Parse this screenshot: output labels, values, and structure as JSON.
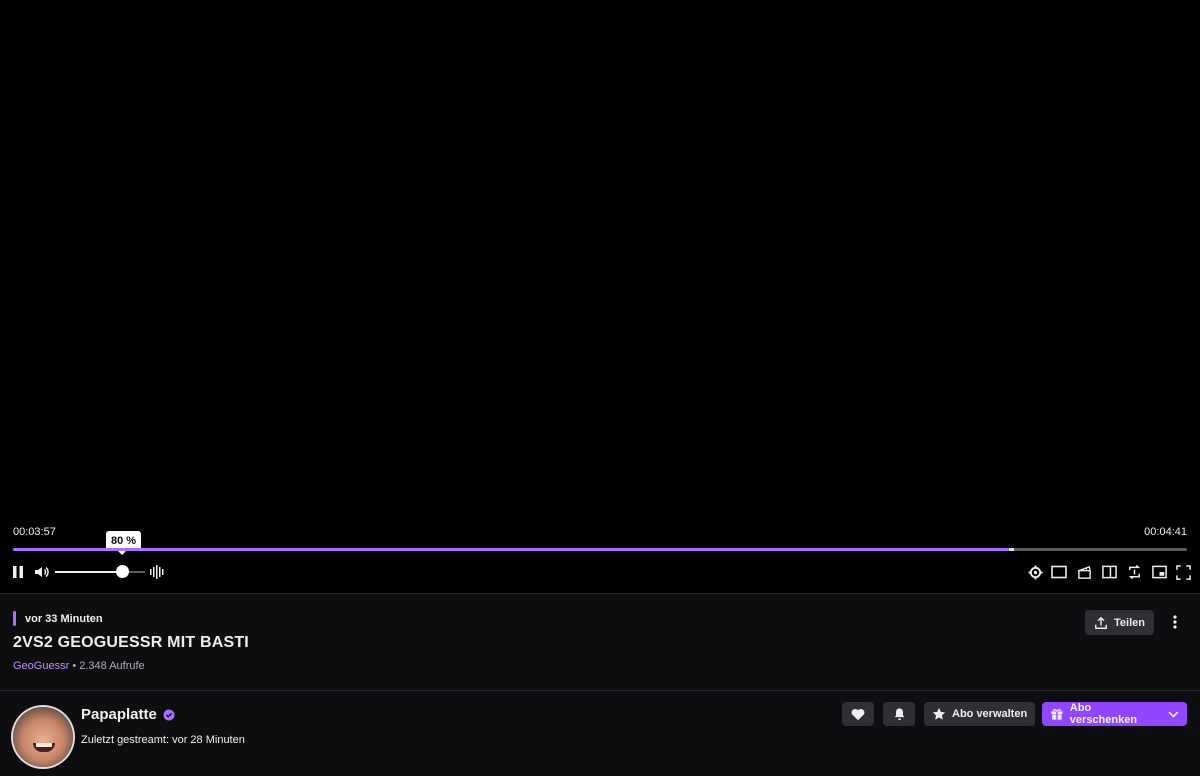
{
  "player": {
    "current_time": "00:03:57",
    "duration": "00:04:41",
    "progress_fraction": 0.848,
    "buffer_end_fraction": 0.853,
    "volume_tooltip": "80 %",
    "volume_fraction": 0.75,
    "accent_color": "#a970ff",
    "left_controls": [
      "pause-icon",
      "volume-icon",
      "audio-waveform-icon"
    ],
    "right_controls": [
      "settings-icon",
      "theatre-mode-icon",
      "clip-icon",
      "sidebar-toggle-icon",
      "sync-icon",
      "picture-in-picture-icon",
      "fullscreen-icon"
    ]
  },
  "video": {
    "time_ago": "vor 33 Minuten",
    "title": "2VS2 GEOGUESSR MIT BASTI",
    "game": "GeoGuessr",
    "separator": "•",
    "views": "2.348 Aufrufe",
    "share_label": "Teilen"
  },
  "channel": {
    "name": "Papaplatte",
    "verified": true,
    "last_streamed": "Zuletzt gestreamt: vor 28 Minuten",
    "manage_sub_label": "Abo verwalten",
    "gift_sub_label": "Abo verschenken",
    "gift_color": "#9147ff"
  }
}
